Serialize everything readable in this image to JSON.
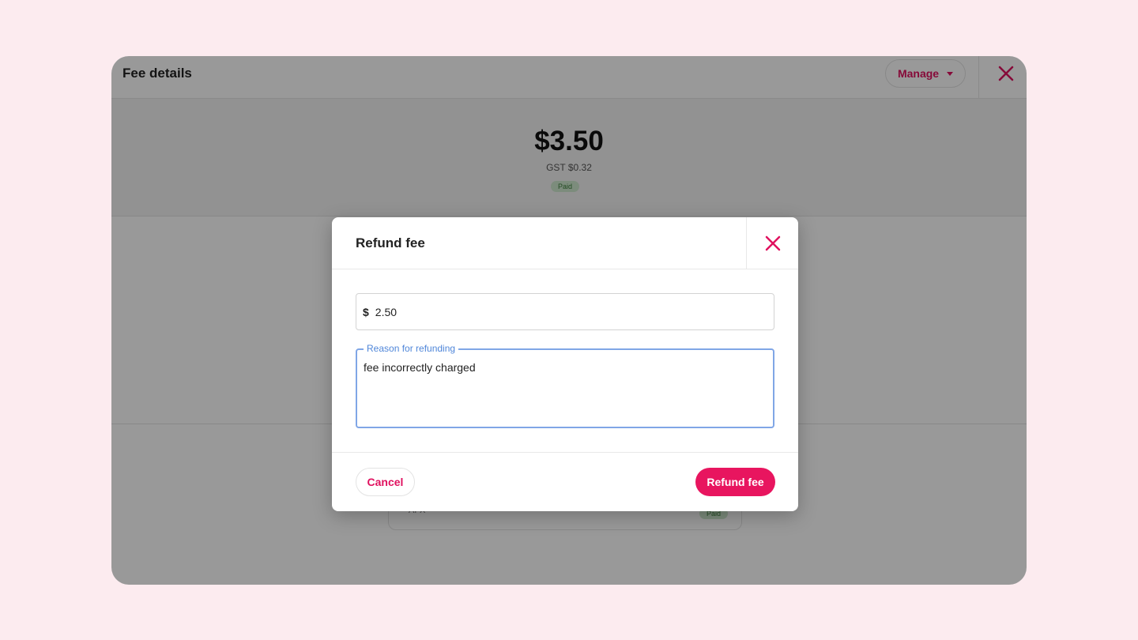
{
  "window": {
    "title": "Fee details",
    "manage_label": "Manage",
    "fee": {
      "amount": "$3.50",
      "gst": "GST $0.32",
      "status": "Paid"
    },
    "list_card": {
      "label": "AFX",
      "status": "Paid"
    }
  },
  "modal": {
    "title": "Refund fee",
    "amount_field": {
      "currency": "$",
      "value": "2.50"
    },
    "reason_field": {
      "label": "Reason for refunding",
      "value": "fee incorrectly charged"
    },
    "cancel_label": "Cancel",
    "submit_label": "Refund fee"
  },
  "colors": {
    "accent": "#e0115f",
    "focus": "#80a6e6",
    "paid_badge_bg": "#cfe9cf",
    "page_bg": "#fcebef"
  },
  "icons": {
    "close": "close-icon",
    "caret": "caret-down-icon"
  }
}
